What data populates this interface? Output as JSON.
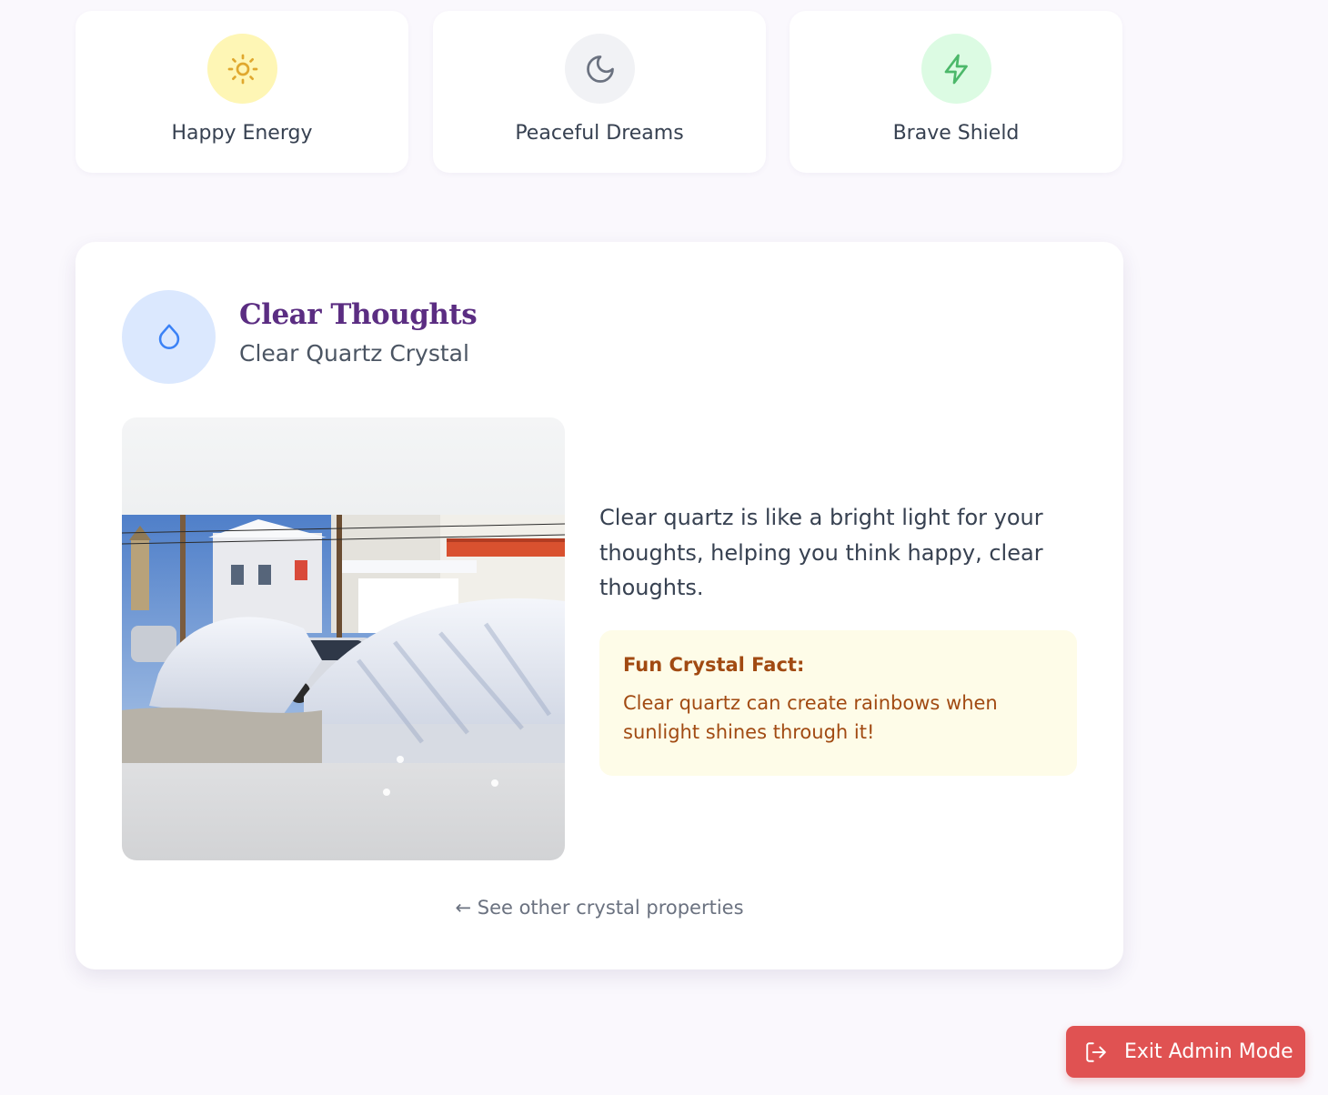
{
  "properties": [
    {
      "label": "Happy Energy",
      "icon": "sun-icon",
      "color": "#e0a82e"
    },
    {
      "label": "Peaceful Dreams",
      "icon": "moon-icon",
      "color": "#6b7280"
    },
    {
      "label": "Brave Shield",
      "icon": "lightning-icon",
      "color": "#4cb86a"
    }
  ],
  "detail": {
    "icon": "water-drop-icon",
    "icon_color": "#3b82f6",
    "title": "Clear Thoughts",
    "subtitle": "Clear Quartz Crystal",
    "description": "Clear quartz is like a bright light for your thoughts, helping you think happy, clear thoughts.",
    "fact_title": "Fun Crystal Fact:",
    "fact_text": "Clear quartz can create rainbows when sunlight shines through it!",
    "back_link": "← See other crystal properties",
    "title_color": "#5b2d82",
    "fact_color": "#a14a12"
  },
  "admin": {
    "exit_label": "Exit Admin Mode",
    "exit_icon": "logout-icon",
    "button_color": "#e05252"
  }
}
